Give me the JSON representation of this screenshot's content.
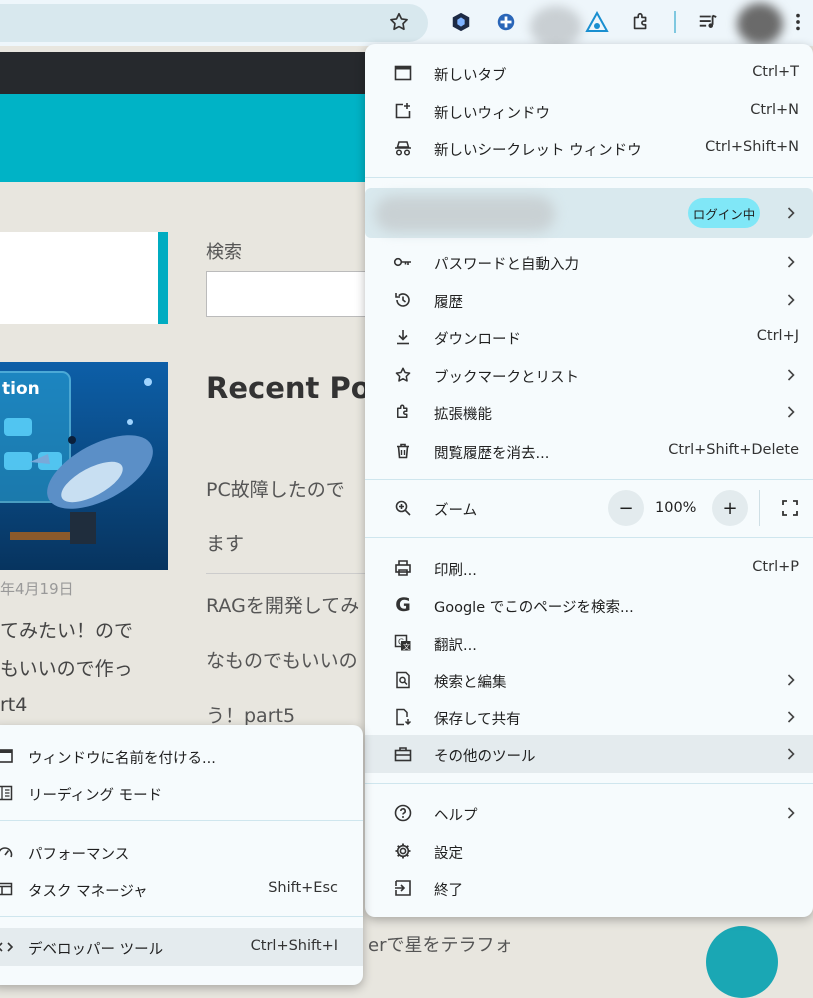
{
  "browser": {
    "colors": {
      "accent": "#00b3c6",
      "menu_bg": "#f6fbfd",
      "login_badge": "#80e7f7"
    },
    "toolbar_icons": [
      "star-icon",
      "extension-hexagon-icon",
      "extension-plus-icon",
      "extension-triangle-icon",
      "puzzle-icon",
      "media-icon",
      "avatar",
      "more-vert-icon"
    ]
  },
  "page": {
    "search_label": "検索",
    "recent_heading": "Recent Pos",
    "post_date": "年4月19日",
    "left_lines": [
      "てみたい！ので",
      "もいいので作っ",
      "rt4"
    ],
    "right_lines": [
      "PC故障したので",
      "ます",
      "RAGを開発してみ",
      "なものでもいいの",
      "う！part5"
    ],
    "bottom_text": "erで星をテラフォ"
  },
  "main_menu": {
    "new_tab": {
      "label": "新しいタブ",
      "shortcut": "Ctrl+T"
    },
    "new_window": {
      "label": "新しいウィンドウ",
      "shortcut": "Ctrl+N"
    },
    "new_incognito": {
      "label": "新しいシークレット ウィンドウ",
      "shortcut": "Ctrl+Shift+N"
    },
    "profile_badge": "ログイン中",
    "passwords": {
      "label": "パスワードと自動入力"
    },
    "history": {
      "label": "履歴"
    },
    "downloads": {
      "label": "ダウンロード",
      "shortcut": "Ctrl+J"
    },
    "bookmarks": {
      "label": "ブックマークとリスト"
    },
    "extensions": {
      "label": "拡張機能"
    },
    "clear_data": {
      "label": "閲覧履歴を消去...",
      "shortcut": "Ctrl+Shift+Delete"
    },
    "zoom": {
      "label": "ズーム",
      "minus": "−",
      "value": "100%",
      "plus": "+"
    },
    "print": {
      "label": "印刷...",
      "shortcut": "Ctrl+P"
    },
    "google_search": {
      "label": "Google でこのページを検索..."
    },
    "translate": {
      "label": "翻訳..."
    },
    "search_edit": {
      "label": "検索と編集"
    },
    "save_share": {
      "label": "保存して共有"
    },
    "more_tools": {
      "label": "その他のツール"
    },
    "help": {
      "label": "ヘルプ"
    },
    "settings": {
      "label": "設定"
    },
    "exit": {
      "label": "終了"
    }
  },
  "sub_menu": {
    "name_window": {
      "label": "ウィンドウに名前を付ける..."
    },
    "reading_mode": {
      "label": "リーディング モード"
    },
    "performance": {
      "label": "パフォーマンス"
    },
    "task_manager": {
      "label": "タスク マネージャ",
      "shortcut": "Shift+Esc"
    },
    "dev_tools": {
      "label": "デベロッパー ツール",
      "shortcut": "Ctrl+Shift+I"
    }
  }
}
